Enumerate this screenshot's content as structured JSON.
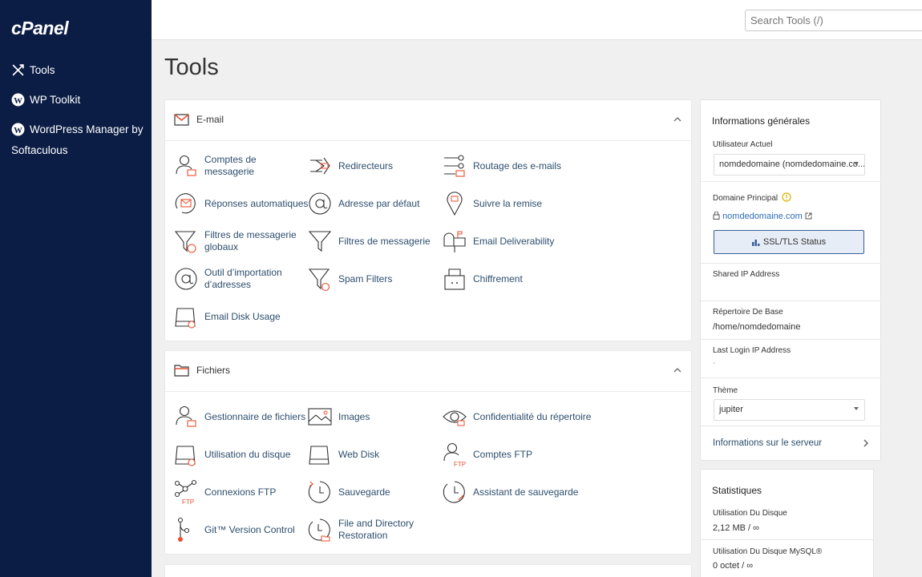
{
  "sidebar": {
    "logo": "cPanel",
    "items": [
      {
        "label": "Tools"
      },
      {
        "label": "WP Toolkit"
      },
      {
        "label": "WordPress Manager by Softaculous"
      }
    ]
  },
  "search": {
    "placeholder": "Search Tools (/)"
  },
  "page_title": "Tools",
  "email_section": {
    "title": "E-mail",
    "tools": [
      "Comptes de messagerie",
      "Redirecteurs",
      "Routage des e-mails",
      "Réponses automatiques",
      "Adresse par défaut",
      "Suivre la remise",
      "Filtres de messagerie globaux",
      "Filtres de messagerie",
      "Email Deliverability",
      "Outil d’importation d’adresses",
      "Spam Filters",
      "Chiffrement",
      "Email Disk Usage"
    ]
  },
  "files_section": {
    "title": "Fichiers",
    "tools": [
      "Gestionnaire de fichiers",
      "Images",
      "Confidentialité du répertoire",
      "Utilisation du disque",
      "Web Disk",
      "Comptes FTP",
      "Connexions FTP",
      "Sauvegarde",
      "Assistant de sauvegarde",
      "Git™ Version Control",
      "File and Directory Restoration"
    ]
  },
  "info": {
    "title": "Informations générales",
    "current_user_label": "Utilisateur Actuel",
    "current_user_value": "nomdedomaine (nomdedomaine.co...",
    "primary_domain_label": "Domaine Principal",
    "primary_domain_value": "nomdedomaine.com",
    "ssl_button": "SSL/TLS Status",
    "shared_ip_label": "Shared IP Address",
    "home_dir_label": "Répertoire De Base",
    "home_dir_value": "/home/nomdedomaine",
    "last_login_label": "Last Login IP Address",
    "last_login_value": "-",
    "theme_label": "Thème",
    "theme_value": "jupiter",
    "server_info_link": "Informations sur le serveur"
  },
  "stats": {
    "title": "Statistiques",
    "disk_usage_label": "Utilisation Du Disque",
    "disk_usage_value": "2,12 MB / ∞",
    "mysql_usage_label": "Utilisation Du Disque MySQL®",
    "mysql_usage_value": "0 octet / ∞"
  },
  "colors": {
    "sidebar": "#0b1d45",
    "accent": "#e8502f",
    "link": "#2d6db5"
  }
}
